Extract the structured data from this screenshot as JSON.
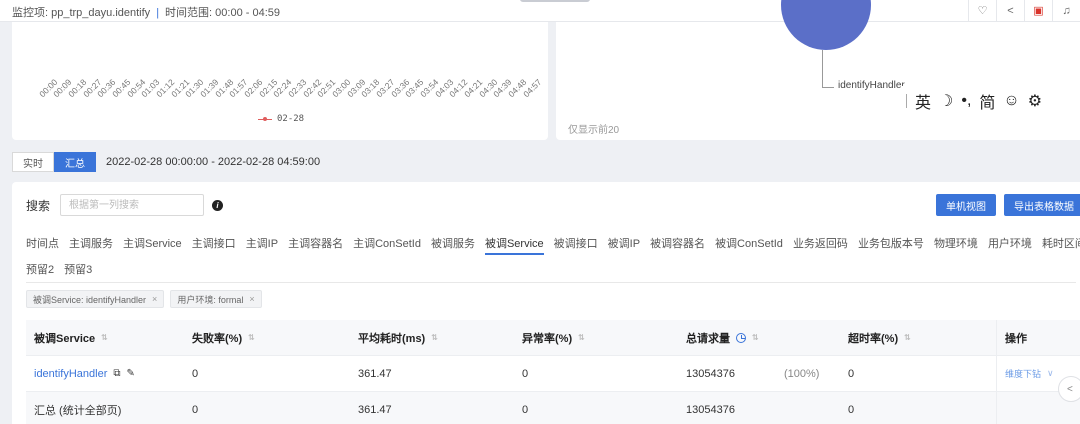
{
  "topbar": {
    "monitor_label": "监控项: pp_trp_dayu.identify",
    "separator": "|",
    "time_label": "时间范围: 00:00 - 04:59",
    "icons": [
      "heart-icon",
      "share-icon",
      "bookmark-icon",
      "bell-icon"
    ]
  },
  "line_chart": {
    "x_ticks": [
      "00:00",
      "00:09",
      "00:18",
      "00:27",
      "00:36",
      "00:45",
      "00:54",
      "01:03",
      "01:12",
      "01:21",
      "01:30",
      "01:39",
      "01:48",
      "01:57",
      "02:06",
      "02:15",
      "02:24",
      "02:33",
      "02:42",
      "02:51",
      "03:00",
      "03:09",
      "03:18",
      "03:27",
      "03:36",
      "03:45",
      "03:54",
      "04:03",
      "04:12",
      "04:21",
      "04:30",
      "04:39",
      "04:48",
      "04:57"
    ],
    "legend": "02-28",
    "series_color": "#e05d5d"
  },
  "pie_chart": {
    "slice_label": "identifyHandler",
    "slice_color": "#5b6fc8",
    "note": "仅显示前20"
  },
  "ime_toolbar": {
    "lang": "英",
    "moon": "☽",
    "punct": "•,",
    "script": "简",
    "emoji": "☺",
    "gear": "⚙"
  },
  "mode": {
    "realtime": "实时",
    "summary": "汇总",
    "date_range": "2022-02-28 00:00:00 - 2022-02-28 04:59:00"
  },
  "search": {
    "label": "搜索",
    "placeholder": "根据第一列搜索",
    "single_view_btn": "单机视图",
    "export_btn": "导出表格数据"
  },
  "dimension_tabs": {
    "row1": [
      "时间点",
      "主调服务",
      "主调Service",
      "主调接口",
      "主调IP",
      "主调容器名",
      "主调ConSetId",
      "被调服务",
      "被调Service",
      "被调接口",
      "被调IP",
      "被调容器名",
      "被调ConSetId",
      "业务返回码",
      "业务包版本号",
      "物理环境",
      "用户环境",
      "耗时区间"
    ],
    "row2": [
      "预留2",
      "预留3"
    ],
    "active": "被调Service"
  },
  "filters": [
    {
      "label": "被调Service: identifyHandler",
      "close": "×"
    },
    {
      "label": "用户环境: formal",
      "close": "×"
    }
  ],
  "table": {
    "headers": [
      "被调Service",
      "失败率(%)",
      "平均耗时(ms)",
      "异常率(%)",
      "总请求量",
      "超时率(%)",
      "操作"
    ],
    "sort_glyph": "⇅",
    "rows": [
      {
        "service": "identifyHandler",
        "fail": "0",
        "avg": "361.47",
        "abnormal": "0",
        "total": "13054376",
        "pct": "(100%)",
        "timeout": "0",
        "op": "维度下钻",
        "op_chev": "∨"
      }
    ],
    "summary_row": {
      "service": "汇总 (统计全部页)",
      "fail": "0",
      "avg": "361.47",
      "abnormal": "0",
      "total": "13054376",
      "timeout": "0"
    }
  }
}
